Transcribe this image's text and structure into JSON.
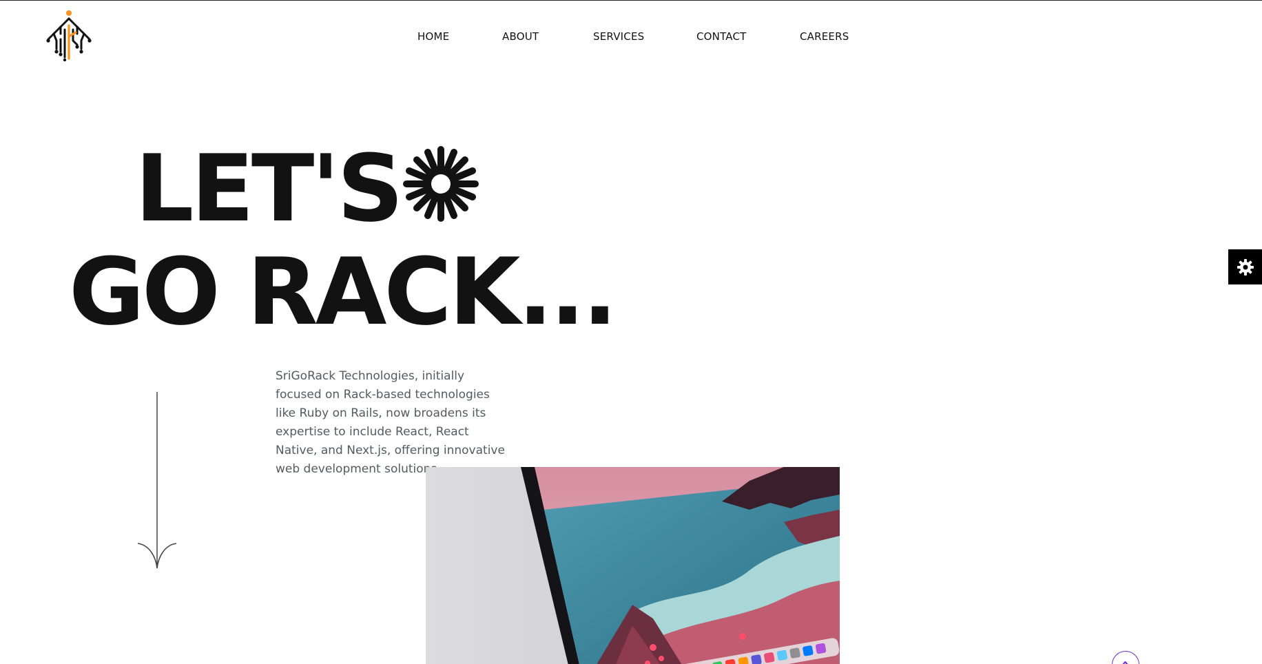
{
  "brand": {
    "logo_icon": "tree-circuit-logo-icon",
    "accent_color": "#f7931e"
  },
  "nav": {
    "items": [
      {
        "label": "HOME"
      },
      {
        "label": "ABOUT"
      },
      {
        "label": "SERVICES"
      },
      {
        "label": "CONTACT"
      },
      {
        "label": "CAREERS"
      }
    ]
  },
  "hero": {
    "line1": "LET'S",
    "line2": "GO RACK...",
    "decoration_icon": "asterisk-icon"
  },
  "intro": {
    "text": "SriGoRack Technologies, initially focused on Rack-based technologies like Ruby on Rails, now broadens its expertise to include React, React Native, and Next.js, offering innovative web development solutions."
  },
  "widgets": {
    "settings_icon": "gear-icon",
    "scroll_top_icon": "chevron-up-icon",
    "scroll_top_color": "#6a2bd6"
  },
  "image": {
    "subject": "laptop-screen-photo"
  }
}
